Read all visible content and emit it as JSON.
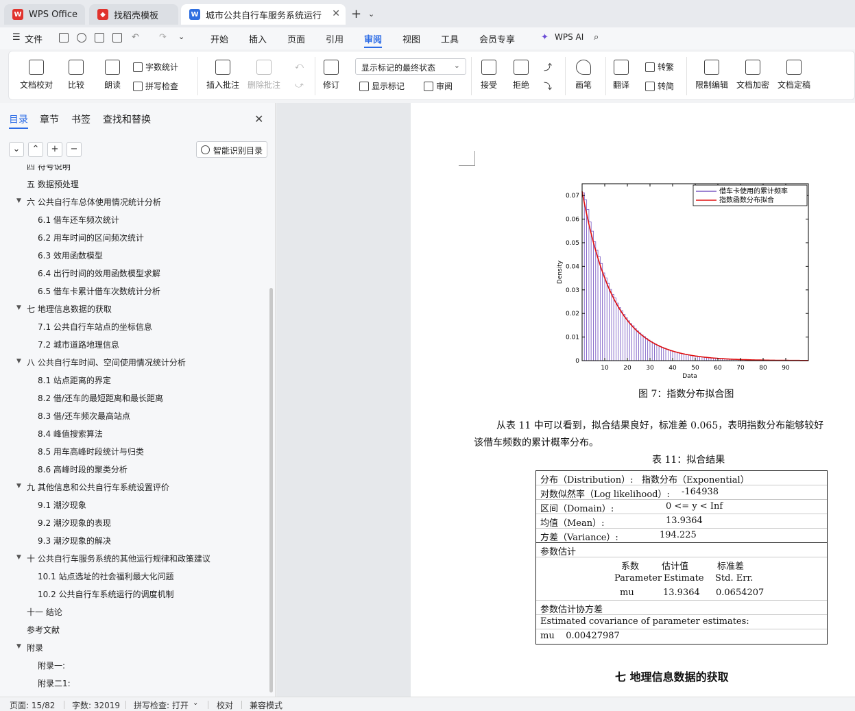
{
  "tabs": {
    "wps_office": "WPS Office",
    "template": "找稻壳模板",
    "document": "城市公共自行车服务系统运行",
    "new_tab": "+",
    "new_tab_caret": "⌄"
  },
  "menu": {
    "file": "文件",
    "items": [
      "开始",
      "插入",
      "页面",
      "引用",
      "审阅",
      "视图",
      "工具",
      "会员专享"
    ],
    "wps_ai": "WPS AI"
  },
  "ribbon": {
    "doc_check": "文档校对",
    "compare": "比较",
    "read_aloud": "朗读",
    "word_count": "字数统计",
    "spell_check": "拼写检查",
    "insert_comment": "插入批注",
    "delete_comment": "删除批注",
    "revise": "修订",
    "markup_state": "显示标记的最终状态",
    "show_markup": "显示标记",
    "review": "审阅",
    "accept": "接受",
    "reject": "拒绝",
    "pen": "画笔",
    "translate": "翻译",
    "to_traditional": "转繁",
    "to_simplified": "转简",
    "restrict_edit": "限制编辑",
    "encrypt": "文档加密",
    "finalize": "文档定稿"
  },
  "sidebar": {
    "tabs": [
      "目录",
      "章节",
      "书签",
      "查找和替换"
    ],
    "smart_toc": "智能识别目录",
    "nav_buttons": [
      "⌄",
      "⌃",
      "+",
      "−"
    ],
    "toc": [
      {
        "level": 1,
        "text": "四  符号说明",
        "caret": ""
      },
      {
        "level": 1,
        "text": "五  数据预处理",
        "caret": ""
      },
      {
        "level": 1,
        "text": "六  公共自行车总体使用情况统计分析",
        "caret": "▼"
      },
      {
        "level": 2,
        "text": "6.1 借车还车频次统计",
        "caret": ""
      },
      {
        "level": 2,
        "text": "6.2 用车时间的区间频次统计",
        "caret": ""
      },
      {
        "level": 2,
        "text": "6.3 效用函数模型",
        "caret": ""
      },
      {
        "level": 2,
        "text": "6.4 出行时间的效用函数模型求解",
        "caret": ""
      },
      {
        "level": 2,
        "text": "6.5  借车卡累计借车次数统计分析",
        "caret": ""
      },
      {
        "level": 1,
        "text": "七  地理信息数据的获取",
        "caret": "▼"
      },
      {
        "level": 2,
        "text": "7.1 公共自行车站点的坐标信息",
        "caret": ""
      },
      {
        "level": 2,
        "text": "7.2  城市道路地理信息",
        "caret": ""
      },
      {
        "level": 1,
        "text": "八  公共自行车时间、空间使用情况统计分析",
        "caret": "▼"
      },
      {
        "level": 2,
        "text": "8.1  站点距离的界定",
        "caret": ""
      },
      {
        "level": 2,
        "text": "8.2  借/还车的最短距离和最长距离",
        "caret": ""
      },
      {
        "level": 2,
        "text": "8.3  借/还车频次最高站点",
        "caret": ""
      },
      {
        "level": 2,
        "text": "8.4  峰值搜索算法",
        "caret": ""
      },
      {
        "level": 2,
        "text": "8.5 用车高峰时段统计与归类",
        "caret": ""
      },
      {
        "level": 2,
        "text": "8.6  高峰时段的聚类分析",
        "caret": ""
      },
      {
        "level": 1,
        "text": "九  其他信息和公共自行车系统设置评价",
        "caret": "▼"
      },
      {
        "level": 2,
        "text": "9.1  潮汐现象",
        "caret": ""
      },
      {
        "level": 2,
        "text": "9.2  潮汐现象的表现",
        "caret": ""
      },
      {
        "level": 2,
        "text": "9.3  潮汐现象的解决",
        "caret": ""
      },
      {
        "level": 1,
        "text": "十  公共自行车服务系统的其他运行规律和政策建议",
        "caret": "▼"
      },
      {
        "level": 2,
        "text": "10.1  站点选址的社会福利最大化问题",
        "caret": ""
      },
      {
        "level": 2,
        "text": "10.2  公共自行车系统运行的调度机制",
        "caret": ""
      },
      {
        "level": 1,
        "text": "十一  结论",
        "caret": ""
      },
      {
        "level": 1,
        "text": "参考文献",
        "caret": ""
      },
      {
        "level": 1,
        "text": "附录",
        "caret": "▼"
      },
      {
        "level": 2,
        "text": "附录一:",
        "caret": ""
      },
      {
        "level": 2,
        "text": "附录二1:",
        "caret": ""
      }
    ]
  },
  "document": {
    "figure_caption": "图 7：指数分布拟合图",
    "paragraph_line1": "从表 11 中可以看到，拟合结果良好，标准差 0.065，表明指数分布能够较好",
    "paragraph_line2": "该借车频数的累计概率分布。",
    "table_caption": "表 11：拟合结果",
    "table": {
      "distribution_label": "分布（Distribution）:",
      "distribution_value": "指数分布（Exponential）",
      "loglik_label": "对数似然率（Log likelihood）:",
      "loglik_value": "-164938",
      "domain_label": "区间（Domain）:",
      "domain_value": "0 <= y < Inf",
      "mean_label": "均值（Mean）:",
      "mean_value": "13.9364",
      "variance_label": "方差（Variance）:",
      "variance_value": "194.225",
      "param_est_label": "参数估计",
      "col_headers_cn": [
        "系数",
        "估计值",
        "标准差"
      ],
      "col_headers_en": [
        "Parameter",
        "Estimate",
        "Std. Err."
      ],
      "param_row": [
        "mu",
        "13.9364",
        "0.0654207"
      ],
      "cov_label_cn": "参数估计协方差",
      "cov_label_en": "Estimated covariance of parameter estimates:",
      "cov_row": "mu    0.00427987"
    },
    "section_title": "七  地理信息数据的获取"
  },
  "chart_data": {
    "type": "bar",
    "xlabel": "Data",
    "ylabel": "Density",
    "xlim": [
      0,
      100
    ],
    "ylim": [
      0,
      0.075
    ],
    "xticks": [
      10,
      20,
      30,
      40,
      50,
      60,
      70,
      80,
      90
    ],
    "yticks": [
      0,
      0.01,
      0.02,
      0.03,
      0.04,
      0.05,
      0.06,
      0.07
    ],
    "ytick_labels": [
      "0",
      "0.01",
      "0.02",
      "0.03",
      "0.04",
      "0.05",
      "0.06",
      "0.07"
    ],
    "histogram_color": "#7b5cc4",
    "fit_color": "#e01010",
    "legend": [
      "借车卡使用的累计频率",
      "指数函数分布拟合"
    ],
    "legend_position": "top-right",
    "series": [
      {
        "name": "借车卡使用的累计频率",
        "type": "histogram",
        "bin_width": 1,
        "values": [
          0.0712,
          0.0682,
          0.0641,
          0.0588,
          0.0549,
          0.0504,
          0.0468,
          0.0441,
          0.0412,
          0.0372,
          0.0351,
          0.0328,
          0.0302,
          0.0281,
          0.0266,
          0.0244,
          0.0225,
          0.0212,
          0.0196,
          0.0182,
          0.0169,
          0.0157,
          0.0148,
          0.0136,
          0.0126,
          0.0117,
          0.0109,
          0.0102,
          0.0094,
          0.0087,
          0.0081,
          0.0075,
          0.007,
          0.0065,
          0.006,
          0.0056,
          0.0052,
          0.0048,
          0.0045,
          0.0042,
          0.0039,
          0.0036,
          0.0033,
          0.0031,
          0.0029,
          0.0027,
          0.0025,
          0.0023,
          0.0021,
          0.002,
          0.0018,
          0.0017,
          0.0016,
          0.0015,
          0.0014,
          0.0013,
          0.0012,
          0.0011,
          0.001,
          0.0009,
          0.0009,
          0.0008,
          0.0007,
          0.0007,
          0.0006,
          0.0006,
          0.0005,
          0.0005,
          0.0005,
          0.0004,
          0.0004,
          0.0004,
          0.0003,
          0.0003,
          0.0003,
          0.0003,
          0.0002,
          0.0002,
          0.0002,
          0.0002
        ]
      },
      {
        "name": "指数函数分布拟合",
        "type": "line",
        "mean": 13.9364
      }
    ]
  },
  "statusbar": {
    "page": "页面: 15/82",
    "words": "字数: 32019",
    "spell": "拼写检查: 打开",
    "proof": "校对",
    "compat": "兼容模式"
  },
  "colors": {
    "accent": "#2b6be6",
    "wps_red": "#e0332d",
    "doc_blue": "#2f6fe0"
  }
}
